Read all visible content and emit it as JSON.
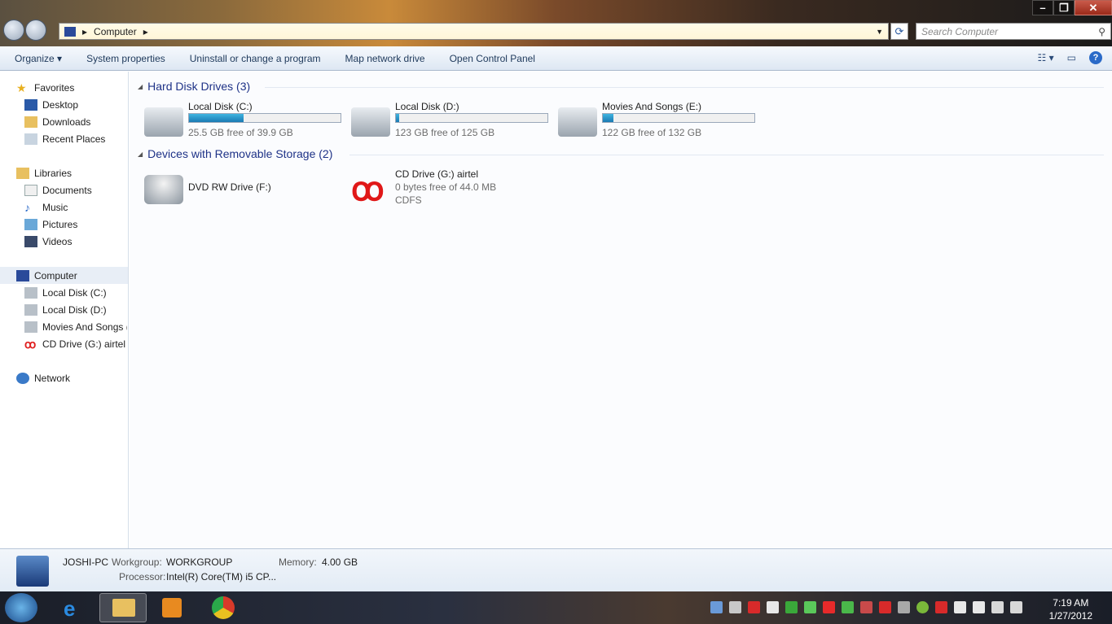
{
  "window": {
    "minimize": "–",
    "restore": "❐",
    "close": "✕"
  },
  "address": {
    "path": "Computer",
    "sep": "▸"
  },
  "search": {
    "placeholder": "Search Computer"
  },
  "toolbar": {
    "organize": "Organize ▾",
    "system_properties": "System properties",
    "uninstall": "Uninstall or change a program",
    "map_drive": "Map network drive",
    "control_panel": "Open Control Panel"
  },
  "sidebar": {
    "favorites": "Favorites",
    "desktop": "Desktop",
    "downloads": "Downloads",
    "recent": "Recent Places",
    "libraries": "Libraries",
    "documents": "Documents",
    "music": "Music",
    "pictures": "Pictures",
    "videos": "Videos",
    "computer": "Computer",
    "c": "Local Disk (C:)",
    "d": "Local Disk (D:)",
    "e": "Movies And Songs (",
    "g": "CD Drive (G:) airtel",
    "network": "Network"
  },
  "groups": {
    "hdd": "Hard Disk Drives (3)",
    "removable": "Devices with Removable Storage (2)"
  },
  "drives": [
    {
      "name": "Local Disk (C:)",
      "free": "25.5 GB free of 39.9 GB",
      "used_fraction": 0.36
    },
    {
      "name": "Local Disk (D:)",
      "free": "123 GB free of 125 GB",
      "used_fraction": 0.02
    },
    {
      "name": "Movies And Songs (E:)",
      "free": "122 GB free of 132 GB",
      "used_fraction": 0.07
    }
  ],
  "removable": [
    {
      "name": "DVD RW Drive (F:)"
    },
    {
      "name": "CD Drive (G:) airtel",
      "free": "0 bytes free of 44.0 MB",
      "fs": "CDFS"
    }
  ],
  "details": {
    "pc": "JOSHI-PC",
    "wg_label": "Workgroup:",
    "wg": "WORKGROUP",
    "mem_label": "Memory:",
    "mem": "4.00 GB",
    "cpu_label": "Processor:",
    "cpu": "Intel(R) Core(TM) i5 CP..."
  },
  "clock": {
    "time": "7:19 AM",
    "date": "1/27/2012"
  },
  "colors": {
    "accent": "#1e3287",
    "bar": "#2a8fc8"
  }
}
